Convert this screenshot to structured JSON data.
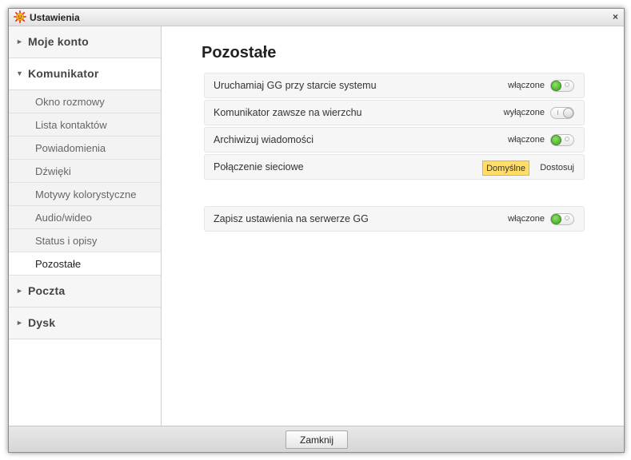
{
  "window": {
    "title": "Ustawienia",
    "close_glyph": "×"
  },
  "sidebar": {
    "sections": [
      {
        "label": "Moje konto",
        "expanded": false
      },
      {
        "label": "Komunikator",
        "expanded": true
      },
      {
        "label": "Poczta",
        "expanded": false
      },
      {
        "label": "Dysk",
        "expanded": false
      }
    ],
    "komunikator_items": [
      "Okno rozmowy",
      "Lista kontaktów",
      "Powiadomienia",
      "Dźwięki",
      "Motywy kolorystyczne",
      "Audio/wideo",
      "Status i opisy",
      "Pozostałe"
    ],
    "active_item": "Pozostałe"
  },
  "main": {
    "title": "Pozostałe",
    "rows": [
      {
        "label": "Uruchamiaj GG przy starcie systemu",
        "state": "włączone",
        "on": true
      },
      {
        "label": "Komunikator zawsze na wierzchu",
        "state": "wyłączone",
        "on": false
      },
      {
        "label": "Archiwizuj wiadomości",
        "state": "włączone",
        "on": true
      },
      {
        "label": "Połączenie sieciowe",
        "option_default": "Domyślne",
        "option_custom": "Dostosuj"
      },
      {
        "label": "Zapisz ustawienia na serwerze GG",
        "state": "włączone",
        "on": true
      }
    ]
  },
  "footer": {
    "close_label": "Zamknij"
  },
  "colors": {
    "toggle_on": "#3aa31a",
    "default_button": "#ffdd66"
  },
  "icons": {
    "app": "gg-sun-icon",
    "arrow_collapsed": "arrow-right-icon",
    "arrow_expanded": "arrow-down-icon"
  }
}
